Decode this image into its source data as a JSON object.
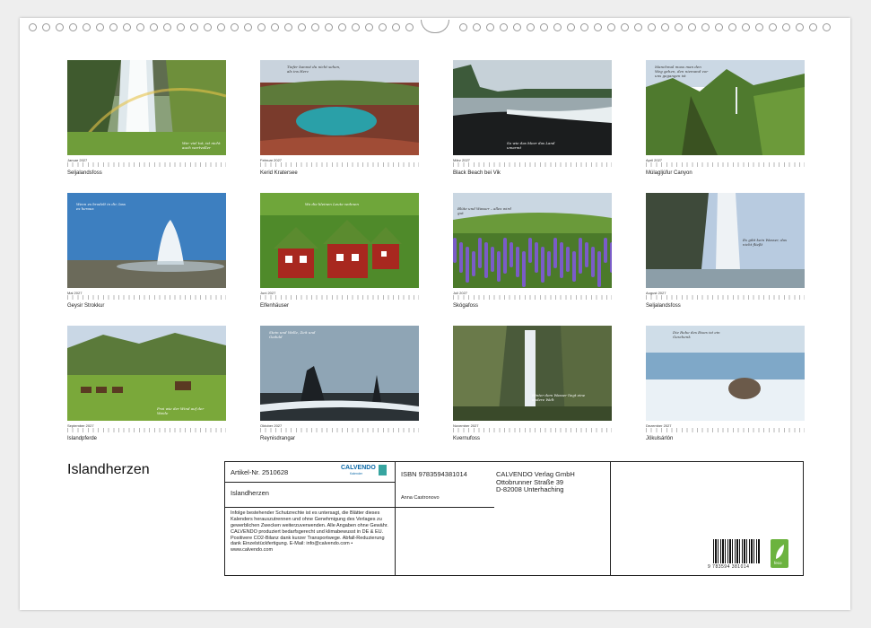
{
  "calendar": {
    "title": "Islandherzen",
    "months": [
      {
        "label": "Januar 2027",
        "name": "Seljalandsfoss",
        "quote": "Wer viel tut, ist nicht auch wertvoller",
        "scene": "waterfall_rainbow"
      },
      {
        "label": "Februar 2027",
        "name": "Kerid Kratersee",
        "quote": "Tiefer kannst du nicht sehen, als ins Herz",
        "scene": "crater"
      },
      {
        "label": "März 2027",
        "name": "Black Beach bei Vik",
        "quote": "So wie das Meer das Land umarmt",
        "scene": "black_beach"
      },
      {
        "label": "April 2027",
        "name": "Múlagljúfur Canyon",
        "quote": "Manchmal muss man den Weg gehen, den niemand vor uns gegangen ist",
        "scene": "canyon"
      },
      {
        "label": "Mai 2027",
        "name": "Geysir Strokkur",
        "quote": "Wenn es brodelt in dir, lass es heraus",
        "scene": "geysir"
      },
      {
        "label": "Juni 2027",
        "name": "Elfenhäuser",
        "quote": "Wo die kleinen Leute wohnen",
        "scene": "elf_houses"
      },
      {
        "label": "Juli 2027",
        "name": "Skógafoss",
        "quote": "Blüte und Wasser – alles wird gut",
        "scene": "lupins"
      },
      {
        "label": "August 2027",
        "name": "Seljalandsfoss",
        "quote": "Es gibt kein Wasser, das nicht fließt",
        "scene": "waterfall_cave"
      },
      {
        "label": "September 2027",
        "name": "Islandpferde",
        "quote": "Frei wie der Wind auf der Weide",
        "scene": "horses"
      },
      {
        "label": "Oktober 2027",
        "name": "Reynisdrangar",
        "quote": "Stein und Welle, Zeit und Geduld",
        "scene": "sea_stacks"
      },
      {
        "label": "November 2027",
        "name": "Kvernufoss",
        "quote": "Hinter dem Wasser liegt eine andere Welt",
        "scene": "kvernufoss"
      },
      {
        "label": "Dezember 2027",
        "name": "Jökulsárlón",
        "quote": "Die Ruhe des Eises ist ein Geschenk",
        "scene": "seal_ice"
      }
    ]
  },
  "info": {
    "article": "Artikel-Nr. 2510628",
    "publisher_logo": "CALVENDO",
    "publisher_logo_sub": "Kalender",
    "book_title": "Islandherzen",
    "legal": "Infolge bestehender Schutzrechte ist es untersagt, die Blätter dieses Kalenders herauszutrennen und ohne Genehmigung des Verlages zu gewerblichen Zwecken weiterzuverwenden. Alle Angaben ohne Gewähr. CALVENDO produziert bedarfsgerecht und klimabewusst in DE & EU. Positivere CO2-Bilanz dank kurzer Transportwege. Abfall-Reduzierung dank Einzelstückfertigung. E-Mail: info@calvendo.com • www.calvendo.com",
    "isbn": "ISBN 9783594381014",
    "author": "Anna Castronovo",
    "publisher": "CALVENDO Verlag GmbH",
    "street": "Ottobrunner Straße 39",
    "city": "D-82008 Unterhaching",
    "barcode_number": "9 783594 381014",
    "eco_label": "feco"
  },
  "colors": {
    "frame": "#222222",
    "logo": "#0d6aa8",
    "eco": "#6cb33f"
  }
}
